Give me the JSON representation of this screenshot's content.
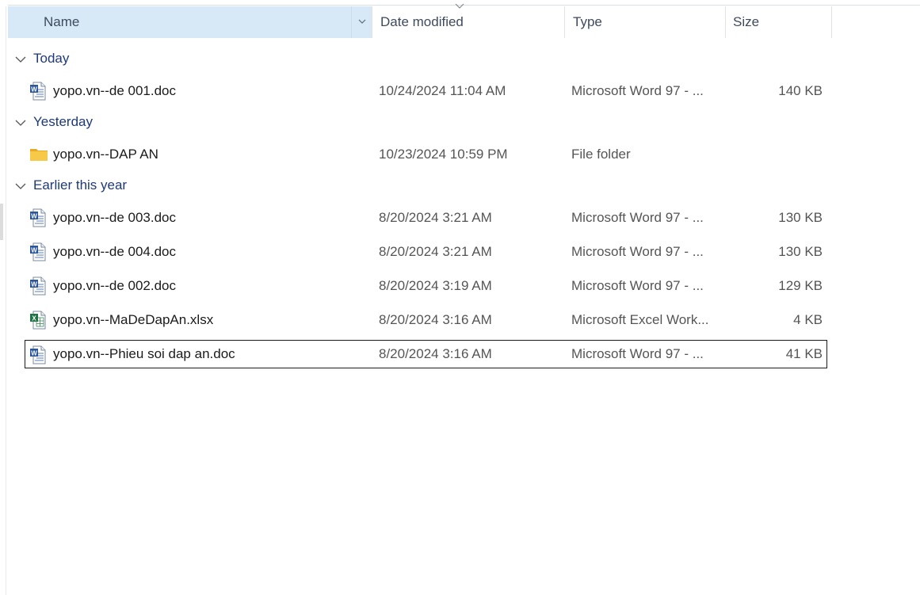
{
  "header": {
    "name": "Name",
    "date_modified": "Date modified",
    "type": "Type",
    "size": "Size"
  },
  "groups": [
    {
      "label": "Today",
      "items": [
        {
          "name": "yopo.vn--de 001.doc",
          "date": "10/24/2024 11:04 AM",
          "type": "Microsoft Word 97 - ...",
          "size": "140 KB",
          "icon": "word-doc-icon"
        }
      ]
    },
    {
      "label": "Yesterday",
      "items": [
        {
          "name": "yopo.vn--DAP AN",
          "date": "10/23/2024 10:59 PM",
          "type": "File folder",
          "size": "",
          "icon": "folder-icon"
        }
      ]
    },
    {
      "label": "Earlier this year",
      "items": [
        {
          "name": "yopo.vn--de 003.doc",
          "date": "8/20/2024 3:21 AM",
          "type": "Microsoft Word 97 - ...",
          "size": "130 KB",
          "icon": "word-doc-icon"
        },
        {
          "name": "yopo.vn--de 004.doc",
          "date": "8/20/2024 3:21 AM",
          "type": "Microsoft Word 97 - ...",
          "size": "130 KB",
          "icon": "word-doc-icon"
        },
        {
          "name": "yopo.vn--de 002.doc",
          "date": "8/20/2024 3:19 AM",
          "type": "Microsoft Word 97 - ...",
          "size": "129 KB",
          "icon": "word-doc-icon"
        },
        {
          "name": "yopo.vn--MaDeDapAn.xlsx",
          "date": "8/20/2024 3:16 AM",
          "type": "Microsoft Excel Work...",
          "size": "4 KB",
          "icon": "excel-xlsx-icon"
        },
        {
          "name": "yopo.vn--Phieu soi dap an.doc",
          "date": "8/20/2024 3:16 AM",
          "type": "Microsoft Word 97 - ...",
          "size": "41 KB",
          "icon": "word-doc-icon",
          "focused": true
        }
      ]
    }
  ],
  "colors": {
    "header_selected": "#d7e8f7",
    "group_text": "#1e3a78",
    "folder": "#f5c344",
    "word_blue": "#2b579a",
    "excel_green": "#217346"
  }
}
